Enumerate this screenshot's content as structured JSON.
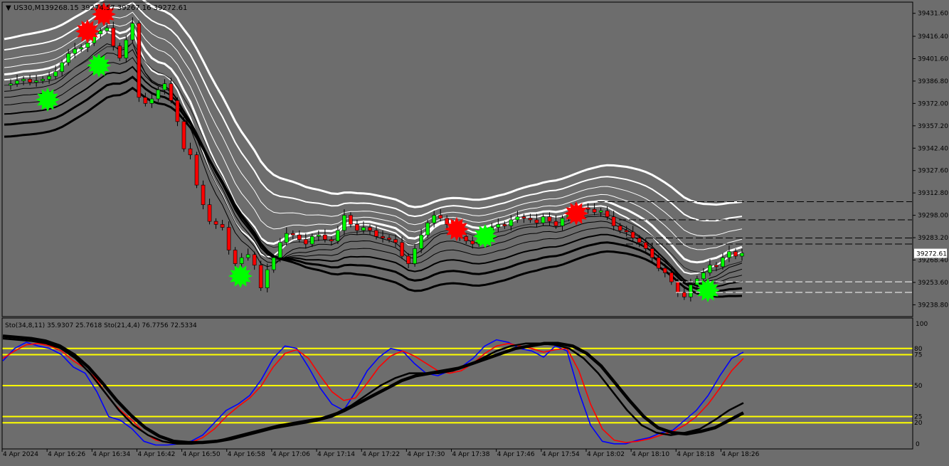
{
  "window": {
    "symbol": "US30,M1",
    "ohlc": "39268.15 39274.57 39267.16 39272.61"
  },
  "price_axis": {
    "labels": [
      "39431.60",
      "39416.40",
      "39401.60",
      "39386.80",
      "39372.00",
      "39357.20",
      "39342.40",
      "39327.60",
      "39312.80",
      "39298.00",
      "39283.20",
      "39268.40",
      "39253.60",
      "39238.80"
    ],
    "current_price": "39272.61"
  },
  "indicator": {
    "label": "Sto(34,8,11) 35.9307 25.7618  Sto(21,4,4) 76.7756 72.5334",
    "scale_top": "100",
    "scale_bottom": "0",
    "levels": [
      {
        "label": "80",
        "value": 80
      },
      {
        "label": "75",
        "value": 75
      },
      {
        "label": "50",
        "value": 50
      },
      {
        "label": "25",
        "value": 25
      },
      {
        "label": "20",
        "value": 20
      }
    ]
  },
  "time_axis": {
    "labels": [
      "4 Apr 2024",
      "4 Apr 16:26",
      "4 Apr 16:34",
      "4 Apr 16:42",
      "4 Apr 16:50",
      "4 Apr 16:58",
      "4 Apr 17:06",
      "4 Apr 17:14",
      "4 Apr 17:22",
      "4 Apr 17:30",
      "4 Apr 17:38",
      "4 Apr 17:46",
      "4 Apr 17:54",
      "4 Apr 18:02",
      "4 Apr 18:10",
      "4 Apr 18:18",
      "4 Apr 18:26"
    ]
  },
  "colors": {
    "background": "#6d6d6d",
    "bull": "#00ff00",
    "bear": "#ff0000",
    "fast_stoch": "#0000ff",
    "slow_stoch": "#ff0000",
    "level_line": "#ffff00",
    "band_upper": "#ffffff",
    "band_lower": "#000000"
  },
  "chart_data": [
    {
      "type": "candlestick",
      "title": "US30,M1",
      "ylim": [
        39231.0,
        39439.0
      ],
      "x": [
        "4 Apr 2024",
        "4 Apr 16:26",
        "4 Apr 16:34",
        "4 Apr 16:42",
        "4 Apr 16:50",
        "4 Apr 16:58",
        "4 Apr 17:06",
        "4 Apr 17:14",
        "4 Apr 17:22",
        "4 Apr 17:30",
        "4 Apr 17:38",
        "4 Apr 17:46",
        "4 Apr 17:54",
        "4 Apr 18:02",
        "4 Apr 18:10",
        "4 Apr 18:18",
        "4 Apr 18:26"
      ],
      "close_points": [
        39384,
        39385,
        39387,
        39388,
        39386,
        39387,
        39388,
        39390,
        39393,
        39399,
        39405,
        39408,
        39409,
        39412,
        39418,
        39420,
        39422,
        39410,
        39402,
        39414,
        39425,
        39376,
        39372,
        39375,
        39381,
        39385,
        39374,
        39360,
        39342,
        39338,
        39318,
        39305,
        39294,
        39292,
        39290,
        39275,
        39266,
        39270,
        39272,
        39265,
        39250,
        39262,
        39270,
        39280,
        39286,
        39285,
        39282,
        39279,
        39284,
        39285,
        39282,
        39281,
        39288,
        39298,
        39292,
        39288,
        39290,
        39288,
        39284,
        39283,
        39282,
        39280,
        39271,
        39266,
        39276,
        39285,
        39293,
        39298,
        39296,
        39292,
        39289,
        39284,
        39281,
        39279,
        39282,
        39287,
        39290,
        39292,
        39291,
        39295,
        39297,
        39296,
        39295,
        39293,
        39297,
        39294,
        39291,
        39296,
        39300,
        39302,
        39303,
        39302,
        39300,
        39301,
        39297,
        39291,
        39288,
        39287,
        39283,
        39280,
        39276,
        39270,
        39263,
        39260,
        39254,
        39247,
        39244,
        39252,
        39256,
        39260,
        39265,
        39264,
        39270,
        39274,
        39271,
        39273
      ],
      "current_price": 39272.61
    },
    {
      "type": "line",
      "title": "Sto(34,8,11) 35.9307 25.7618  Sto(21,4,4) 76.7756 72.5334",
      "ylim": [
        0,
        100
      ],
      "levels": [
        80,
        75,
        50,
        25,
        20
      ],
      "series": [
        {
          "values": [
            70,
            80,
            85,
            82,
            80,
            75,
            65,
            60,
            45,
            25,
            22,
            15,
            5,
            2,
            2,
            3,
            5,
            10,
            20,
            30,
            35,
            42,
            55,
            72,
            82,
            80,
            65,
            48,
            35,
            30,
            45,
            62,
            73,
            80,
            78,
            68,
            60,
            58,
            62,
            65,
            72,
            82,
            87,
            85,
            80,
            78,
            73,
            82,
            78,
            45,
            18,
            5,
            3,
            3,
            6,
            8,
            12,
            14,
            22,
            30,
            42,
            58,
            72,
            77
          ]
        },
        {
          "values": [
            72,
            78,
            83,
            84,
            82,
            78,
            70,
            64,
            55,
            40,
            30,
            22,
            12,
            6,
            4,
            3,
            4,
            8,
            15,
            25,
            33,
            40,
            50,
            65,
            76,
            79,
            72,
            58,
            45,
            38,
            40,
            52,
            65,
            74,
            78,
            74,
            68,
            62,
            60,
            62,
            68,
            76,
            82,
            84,
            82,
            80,
            77,
            79,
            80,
            62,
            35,
            15,
            6,
            4,
            5,
            7,
            10,
            13,
            18,
            25,
            35,
            48,
            62,
            72
          ]
        },
        {
          "values": [
            88,
            87,
            86,
            84,
            80,
            72,
            60,
            45,
            30,
            18,
            10,
            5,
            3,
            3,
            4,
            6,
            9,
            12,
            15,
            18,
            20,
            22,
            24,
            28,
            34,
            42,
            50,
            56,
            60,
            60,
            60,
            62,
            66,
            72,
            78,
            82,
            84,
            84,
            83,
            80,
            72,
            60,
            45,
            30,
            18,
            12,
            10,
            12,
            15,
            22,
            30,
            36
          ]
        },
        {
          "values": [
            90,
            89,
            88,
            86,
            82,
            75,
            65,
            52,
            38,
            26,
            16,
            9,
            5,
            4,
            4,
            5,
            7,
            10,
            13,
            16,
            18,
            20,
            22,
            25,
            30,
            36,
            42,
            48,
            54,
            58,
            60,
            62,
            64,
            68,
            72,
            76,
            80,
            82,
            84,
            84,
            82,
            76,
            66,
            52,
            38,
            25,
            16,
            12,
            11,
            13,
            16,
            22,
            28
          ]
        }
      ]
    }
  ]
}
